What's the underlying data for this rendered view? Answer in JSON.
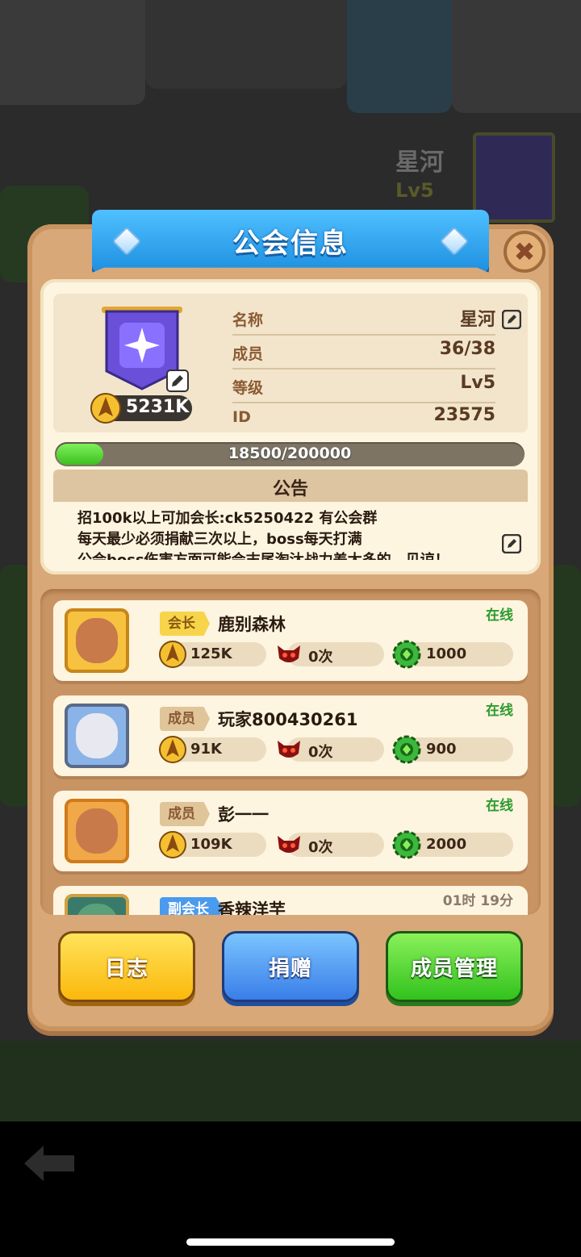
{
  "background": {
    "guild_name": "星河",
    "guild_level": "Lv5"
  },
  "dialog": {
    "title": "公会信息",
    "close_icon": "close-icon"
  },
  "guild": {
    "power": "5231K",
    "rows": [
      {
        "label": "名称",
        "value": "星河"
      },
      {
        "label": "成员",
        "value": "36/38"
      },
      {
        "label": "等级",
        "value": "Lv5"
      },
      {
        "label": "ID",
        "value": "23575"
      }
    ],
    "exp_text": "18500/200000",
    "exp_fraction": 0.0925
  },
  "notice": {
    "title": "公告",
    "lines": [
      "招100k以上可加会长:ck5250422 有公会群",
      "每天最少必须捐献三次以上，boss每天打满",
      "公会boss伤害方面可能会末尾淘汰战力差太多的，见谅！"
    ]
  },
  "members": [
    {
      "role": "会长",
      "name": "鹿别森林",
      "status": "在线",
      "power": "125K",
      "boss": "0次",
      "contribution": "1000"
    },
    {
      "role": "成员",
      "name": "玩家800430261",
      "status": "在线",
      "power": "91K",
      "boss": "0次",
      "contribution": "900"
    },
    {
      "role": "成员",
      "name": "彭一一",
      "status": "在线",
      "power": "109K",
      "boss": "0次",
      "contribution": "2000"
    },
    {
      "role": "副会长",
      "name": "香辣洋芋",
      "status": "01时 19分",
      "power": "",
      "boss": "",
      "contribution": ""
    }
  ],
  "buttons": {
    "log": "日志",
    "donate": "捐赠",
    "manage": "成员管理"
  },
  "colors": {
    "panel": "#d9a878",
    "title_ribbon": "#2ea6f5",
    "online": "#2e9a2e",
    "log_button": "#fcc21c",
    "donate_button": "#4a8ef0",
    "manage_button": "#45d02a"
  }
}
